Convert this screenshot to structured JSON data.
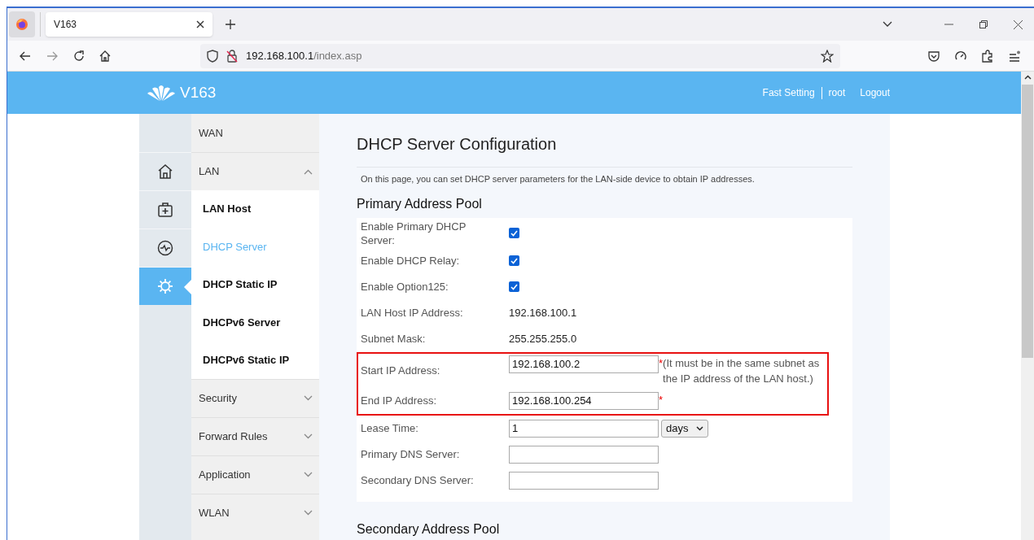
{
  "browser": {
    "tab_title": "V163",
    "url_host": "192.168.100.1",
    "url_path": "/index.asp"
  },
  "header": {
    "brand": "V163",
    "links": [
      "Fast Setting",
      "root",
      "Logout"
    ]
  },
  "icon_rail": [
    {
      "kind": "home",
      "selected": false
    },
    {
      "kind": "kit",
      "selected": false
    },
    {
      "kind": "pulse",
      "selected": false
    },
    {
      "kind": "gear",
      "selected": true
    }
  ],
  "menu": [
    {
      "label": "WAN"
    },
    {
      "label": "LAN",
      "expanded": true,
      "children": [
        {
          "label": "LAN Host",
          "selected": false
        },
        {
          "label": "DHCP Server",
          "selected": true
        },
        {
          "label": "DHCP Static IP",
          "selected": false
        },
        {
          "label": "DHCPv6 Server",
          "selected": false
        },
        {
          "label": "DHCPv6 Static IP",
          "selected": false
        }
      ]
    },
    {
      "label": "Security",
      "expanded": false
    },
    {
      "label": "Forward Rules",
      "expanded": false
    },
    {
      "label": "Application",
      "expanded": false
    },
    {
      "label": "WLAN",
      "expanded": false
    }
  ],
  "content": {
    "title": "DHCP Server Configuration",
    "description": "On this page, you can set DHCP server parameters for the LAN-side device to obtain IP addresses.",
    "primary_pool": {
      "heading": "Primary Address Pool",
      "rows": [
        {
          "kind": "checkbox",
          "label": "Enable Primary DHCP Server:",
          "checked": true,
          "highlighted": false
        },
        {
          "kind": "checkbox",
          "label": "Enable DHCP Relay:",
          "checked": true,
          "highlighted": false
        },
        {
          "kind": "checkbox",
          "label": "Enable Option125:",
          "checked": true,
          "highlighted": false
        },
        {
          "kind": "text",
          "label": "LAN Host IP Address:",
          "value": "192.168.100.1",
          "highlighted": false
        },
        {
          "kind": "text",
          "label": "Subnet Mask:",
          "value": "255.255.255.0",
          "highlighted": false
        },
        {
          "kind": "input",
          "label": "Start IP Address:",
          "value": "192.168.100.2",
          "required_mark": "*",
          "note": "(It must be in the same subnet as the IP address of the LAN host.)",
          "highlighted": true
        },
        {
          "kind": "input",
          "label": "End IP Address:",
          "value": "192.168.100.254",
          "required_mark": "*",
          "highlighted": true
        },
        {
          "kind": "lease",
          "label": "Lease Time:",
          "value": "1",
          "unit": "days",
          "highlighted": false
        },
        {
          "kind": "input",
          "label": "Primary DNS Server:",
          "highlighted": false
        },
        {
          "kind": "input",
          "label": "Secondary DNS Server:",
          "highlighted": false
        }
      ]
    },
    "secondary_pool": {
      "heading": "Secondary Address Pool"
    }
  }
}
